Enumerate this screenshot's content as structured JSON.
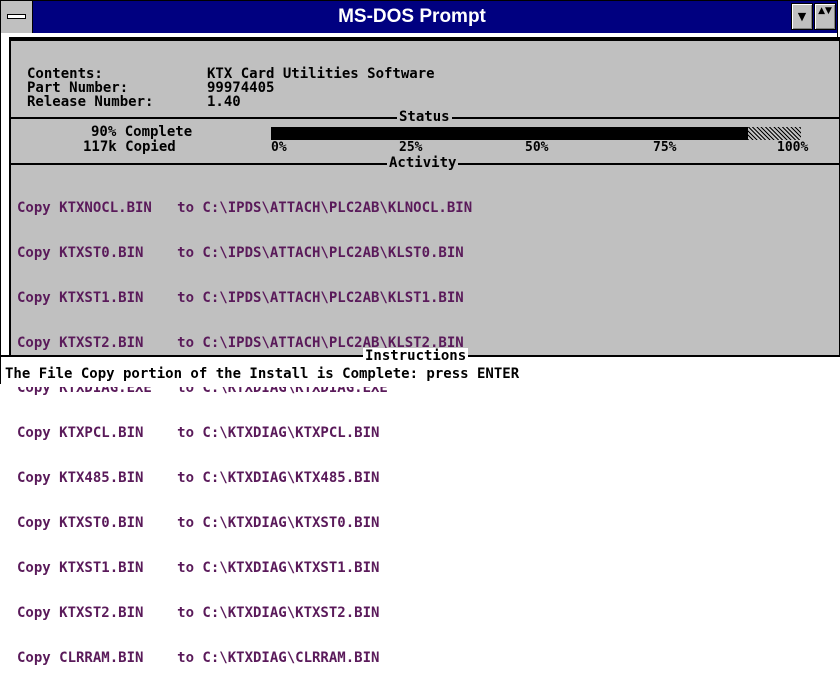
{
  "window": {
    "title": "MS-DOS Prompt",
    "minimize_glyph": "▼",
    "restore_glyph": "▲▼"
  },
  "header": {
    "contents_label": "Contents:",
    "contents_value": "KTX Card Utilities Software",
    "part_number_label": "Part Number:",
    "part_number_value": "99974405",
    "release_label": "Release Number:",
    "release_value": "1.40"
  },
  "status": {
    "label": "Status",
    "percent_text": "90% Complete",
    "copied_text": "117k Copied",
    "progress_fraction": 0.9,
    "ticks": [
      "0%",
      "25%",
      "50%",
      "75%",
      "100%"
    ]
  },
  "activity": {
    "label": "Activity",
    "rows": [
      "Copy KTXNOCL.BIN   to C:\\IPDS\\ATTACH\\PLC2AB\\KLNOCL.BIN",
      "Copy KTXST0.BIN    to C:\\IPDS\\ATTACH\\PLC2AB\\KLST0.BIN",
      "Copy KTXST1.BIN    to C:\\IPDS\\ATTACH\\PLC2AB\\KLST1.BIN",
      "Copy KTXST2.BIN    to C:\\IPDS\\ATTACH\\PLC2AB\\KLST2.BIN",
      "Copy KTXDIAG.EXE   to C:\\KTXDIAG\\KTXDIAG.EXE",
      "Copy KTXPCL.BIN    to C:\\KTXDIAG\\KTXPCL.BIN",
      "Copy KTX485.BIN    to C:\\KTXDIAG\\KTX485.BIN",
      "Copy KTXST0.BIN    to C:\\KTXDIAG\\KTXST0.BIN",
      "Copy KTXST1.BIN    to C:\\KTXDIAG\\KTXST1.BIN",
      "Copy KTXST2.BIN    to C:\\KTXDIAG\\KTXST2.BIN",
      "Copy CLRRAM.BIN    to C:\\KTXDIAG\\CLRRAM.BIN"
    ]
  },
  "instructions": {
    "label": "Instructions",
    "text": "The File Copy portion of the Install is Complete: press ENTER"
  }
}
